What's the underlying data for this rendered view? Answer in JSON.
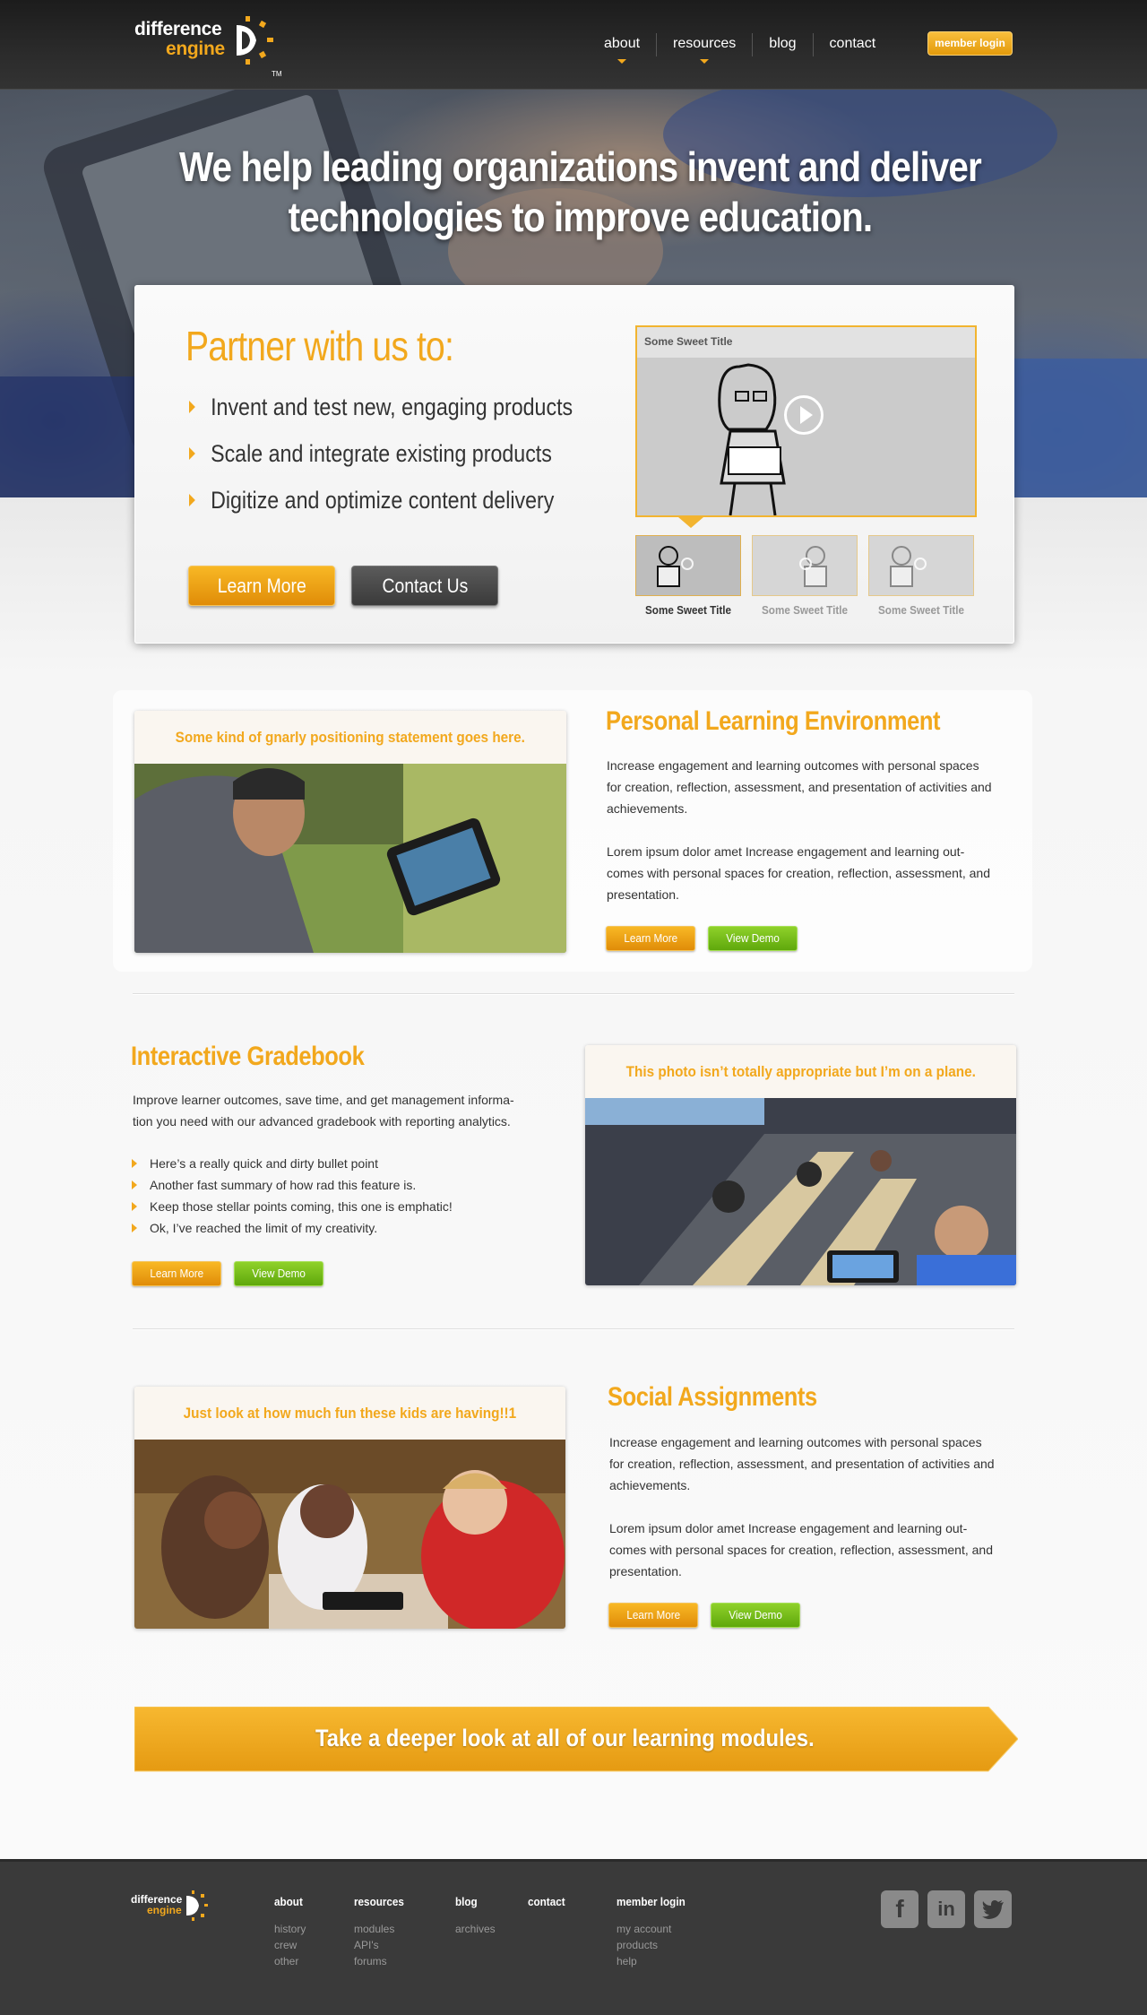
{
  "brand": {
    "line1": "difference",
    "line2": "engine",
    "tm": "TM"
  },
  "nav": {
    "items": [
      "about",
      "resources",
      "blog",
      "contact"
    ],
    "member_login": "member login"
  },
  "hero": {
    "headline": "We help leading organizations invent and deliver technologies to improve education."
  },
  "partner": {
    "title": "Partner with us to:",
    "points": [
      "Invent and test new, engaging products",
      "Scale and integrate existing products",
      "Digitize and optimize content delivery"
    ],
    "learn_more": "Learn More",
    "contact_us": "Contact Us",
    "video": {
      "title": "Some Sweet Title",
      "thumbnails": [
        "Some Sweet Title",
        "Some Sweet Title",
        "Some Sweet Title"
      ]
    }
  },
  "features": [
    {
      "title": "Personal Learning Environment",
      "caption": "Some kind of gnarly positioning statement goes here.",
      "paragraph1": "Increase engagement and learning outcomes with personal spaces for creation, reflection, assessment, and presentation of activities and achievements.",
      "paragraph2": "Lorem ipsum dolor amet Increase engagement and learning out-comes with personal spaces for creation, reflection, assessment, and presentation.",
      "learn_more": "Learn More",
      "view_demo": "View Demo"
    },
    {
      "title": "Interactive Gradebook",
      "caption": "This photo isn’t totally appropriate but I’m on a plane.",
      "paragraph1": "Improve learner outcomes, save time, and get management informa-tion you need with our advanced gradebook with reporting analytics.",
      "bullets": [
        "Here’s a really quick and dirty bullet point",
        "Another fast summary of how rad this feature is.",
        "Keep those stellar points coming, this one is emphatic!",
        "Ok, I’ve reached the limit of my creativity."
      ],
      "learn_more": "Learn More",
      "view_demo": "View Demo"
    },
    {
      "title": "Social Assignments",
      "caption": "Just look at how much fun these kids are having!!1",
      "paragraph1": "Increase engagement and learning outcomes with personal spaces for creation, reflection, assessment, and presentation of activities and achievements.",
      "paragraph2": "Lorem ipsum dolor amet Increase engagement and learning out-comes with personal spaces for creation, reflection, assessment, and presentation.",
      "learn_more": "Learn More",
      "view_demo": "View Demo"
    }
  ],
  "banner": {
    "text": "Take a deeper look at all of our learning modules."
  },
  "footer": {
    "columns": [
      {
        "head": "about",
        "links": [
          "history",
          "crew",
          "other"
        ]
      },
      {
        "head": "resources",
        "links": [
          "modules",
          "API's",
          "forums"
        ]
      },
      {
        "head": "blog",
        "links": [
          "archives"
        ]
      },
      {
        "head": "contact",
        "links": []
      },
      {
        "head": "member login",
        "links": [
          "my account",
          "products",
          "help"
        ]
      }
    ],
    "social": [
      "facebook-icon",
      "linkedin-icon",
      "twitter-icon"
    ]
  },
  "colors": {
    "accent": "#f2a81d",
    "green": "#6db816",
    "dark": "#3a3a3a"
  }
}
